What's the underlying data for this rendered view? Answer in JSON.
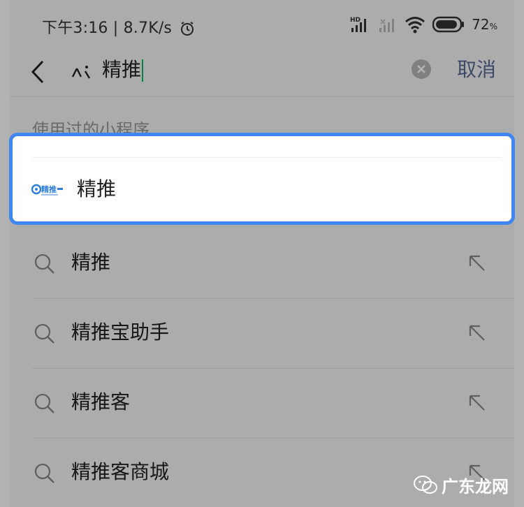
{
  "status_bar": {
    "time_speed": "下午3:16 | 8.7K/s",
    "battery_pct": "72",
    "battery_unit": "%",
    "hd_label": "HD"
  },
  "search": {
    "query": "精推",
    "cancel_label": "取消",
    "back_icon": "back-chevron-icon",
    "miniprogram_icon": "miniprogram-icon",
    "clear_icon": "clear-icon"
  },
  "section": {
    "used_miniprograms_label": "使用过的小程序"
  },
  "highlighted_result": {
    "logo_text": "精推",
    "name": "精推",
    "border_color": "#3f86f0"
  },
  "suggestions": [
    {
      "text": "精推"
    },
    {
      "text": "精推宝助手"
    },
    {
      "text": "精推客"
    },
    {
      "text": "精推客商城"
    }
  ],
  "watermark": {
    "text": "广东龙网"
  },
  "colors": {
    "cancel": "#576b95",
    "caret": "#07c160",
    "highlight_border": "#3f86f0"
  }
}
